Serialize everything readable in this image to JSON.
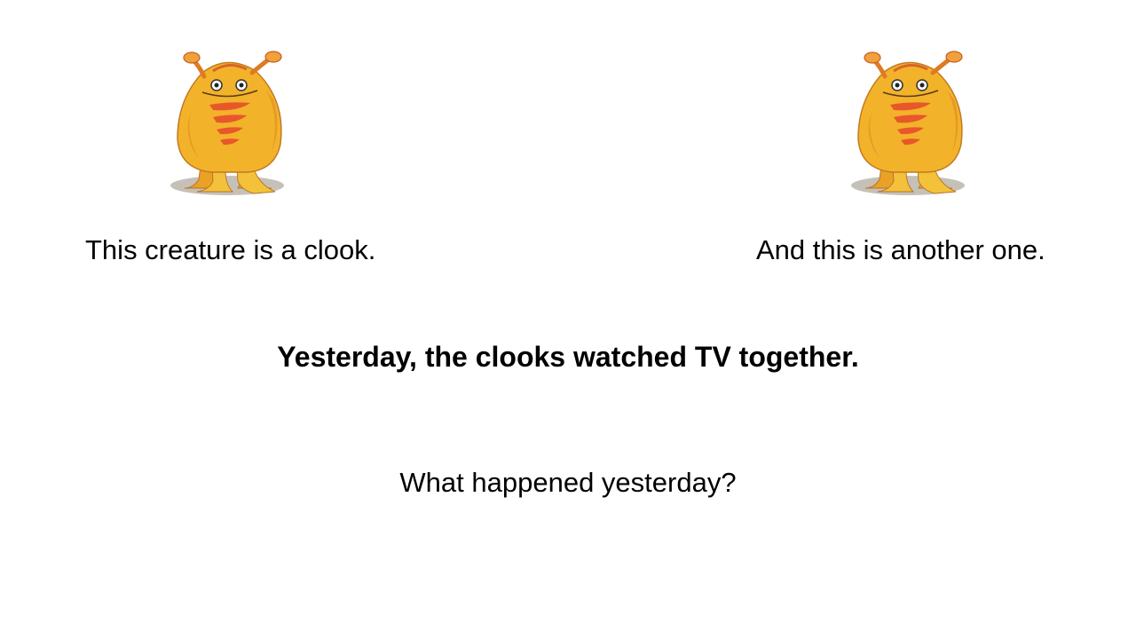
{
  "slide": {
    "left_caption": "This creature is a clook.",
    "right_caption": "And this is another one.",
    "statement": "Yesterday, the clooks watched TV together.",
    "question": "What happened  yesterday?"
  },
  "illustrations": {
    "left": {
      "icon": "clook-creature-illustration",
      "body_color": "#F2B32A",
      "stripe_color": "#E8572A"
    },
    "right": {
      "icon": "clook-creature-illustration",
      "body_color": "#F2B32A",
      "stripe_color": "#E8572A"
    }
  }
}
